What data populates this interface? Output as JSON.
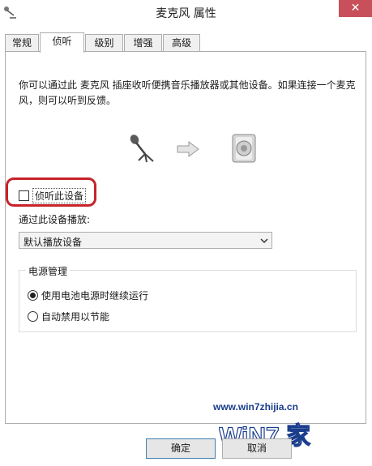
{
  "window": {
    "title": "麦克风 属性",
    "close_glyph": "✕"
  },
  "tabs": [
    {
      "label": "常规",
      "active": false
    },
    {
      "label": "侦听",
      "active": true
    },
    {
      "label": "级别",
      "active": false
    },
    {
      "label": "增强",
      "active": false
    },
    {
      "label": "高级",
      "active": false
    }
  ],
  "listen_tab": {
    "description": "你可以通过此 麦克风 插座收听便携音乐播放器或其他设备。如果连接一个麦克风，则可以听到反馈。",
    "icons": [
      "microphone-icon",
      "arrow-right-icon",
      "speaker-icon"
    ],
    "listen_checkbox": {
      "label": "侦听此设备",
      "checked": false
    },
    "playback_label": "通过此设备播放:",
    "playback_select": {
      "value": "默认播放设备"
    },
    "power": {
      "title": "电源管理",
      "options": [
        {
          "label": "使用电池电源时继续运行",
          "selected": true
        },
        {
          "label": "自动禁用以节能",
          "selected": false
        }
      ]
    }
  },
  "buttons": {
    "ok": "确定",
    "cancel": "取消"
  },
  "watermark": {
    "url": "www.win7zhijia.cn",
    "logo_text": "WiN7.家"
  },
  "colors": {
    "highlight": "#c8222a",
    "close": "#c7505a",
    "watermark": "#1a3d8c"
  }
}
